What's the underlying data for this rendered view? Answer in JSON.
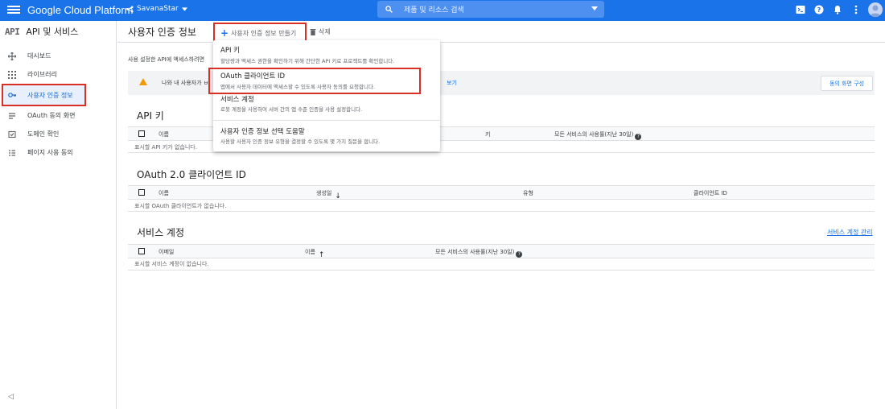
{
  "topbar": {
    "brand": "Google Cloud Platform",
    "project": "SavanaStar",
    "search_placeholder": "제품 및 리소스 검색"
  },
  "sidebar": {
    "badge": "API",
    "title": "API 및 서비스",
    "items": [
      {
        "label": "대시보드",
        "icon": "dashboard-icon"
      },
      {
        "label": "라이브러리",
        "icon": "library-icon"
      },
      {
        "label": "사용자 인증 정보",
        "icon": "key-icon"
      },
      {
        "label": "OAuth 동의 화면",
        "icon": "oauth-icon"
      },
      {
        "label": "도메인 확인",
        "icon": "domain-icon"
      },
      {
        "label": "페이지 사용 동의",
        "icon": "page-agreement-icon"
      }
    ],
    "collapse": "◁"
  },
  "actionbar": {
    "title": "사용자 인증 정보",
    "create_label": "사용자 인증 정보 만들기",
    "delete_label": "삭제"
  },
  "intro": "사용 설정한 API에 액세스하려면",
  "banner": {
    "text": "나와 내 사용자가 ㅂ",
    "link": "보기",
    "button": "동의 화면 구성"
  },
  "api_keys": {
    "title": "API 키",
    "col_name": "이름",
    "col_key": "키",
    "col_usage": "모든 서비스의 사용률(지난 30일)",
    "empty": "표시할 API 키가 없습니다."
  },
  "oauth": {
    "title": "OAuth 2.0 클라이언트 ID",
    "col_name": "이름",
    "col_created": "생성일",
    "col_type": "유형",
    "col_client": "클라이언트 ID",
    "empty": "표시할 OAuth 클라이언트가 없습니다."
  },
  "service_accounts": {
    "title": "서비스 계정",
    "manage": "서비스 계정 관리",
    "col_email": "이메일",
    "col_name": "이름",
    "col_usage": "모든 서비스의 사용률(지난 30일)",
    "empty": "표시할 서비스 계정이 없습니다."
  },
  "menu": {
    "items": [
      {
        "title": "API 키",
        "desc": "할당량과 액세스 권한을 확인하기 위해 간단한 API 키로 프로젝트를 확인합니다."
      },
      {
        "title": "OAuth 클라이언트 ID",
        "desc": "앱에서 사용자 데이터에 액세스할 수 있도록 사용자 동의를 요청합니다."
      },
      {
        "title": "서비스 계정",
        "desc": "로봇 계정을 사용하여 서버 간의 앱 수준 인증을 사용 설정합니다."
      },
      {
        "title": "사용자 인증 정보 선택 도움말",
        "desc": "사용할 사용자 인증 정보 유형을 결정할 수 있도록 몇 가지 질문을 합니다."
      }
    ]
  },
  "colors": {
    "topbar": "#1a73e8",
    "highlight": "#d93025",
    "active_bg": "#e8f0fe",
    "warning": "#f29900"
  }
}
